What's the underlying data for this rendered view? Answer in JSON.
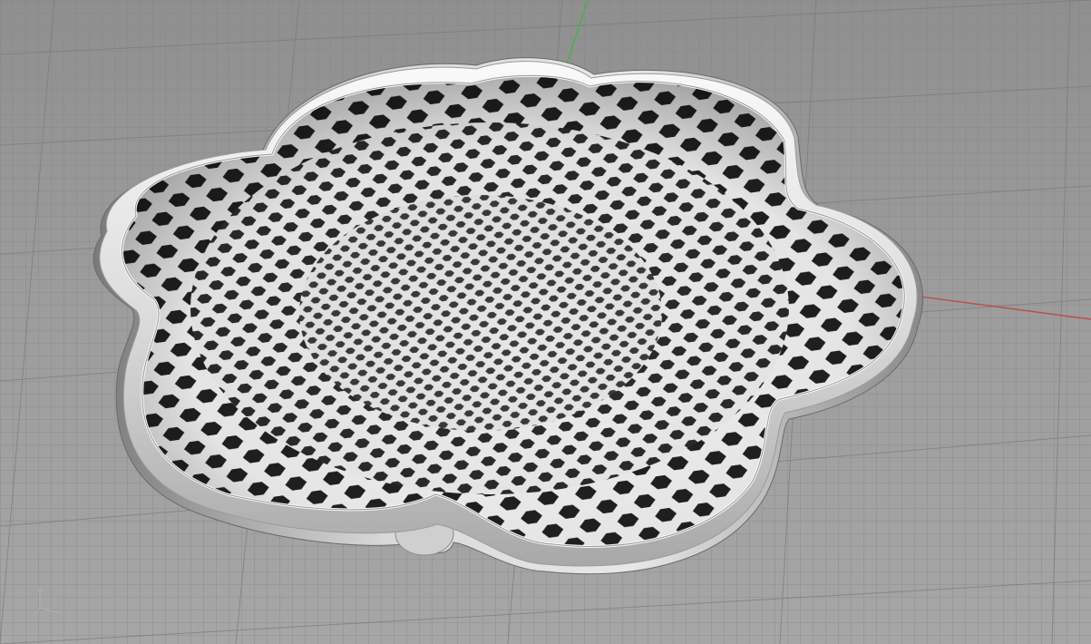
{
  "viewport": {
    "view_name": "Perspective",
    "background_color": "#9a9a9a",
    "grid_color": "#7f7f7f",
    "grid_major_color": "#6f6f6f",
    "x_axis_color": "#c0504d",
    "y_axis_color": "#4caf50"
  },
  "model": {
    "object": "flower-shaped-bowl",
    "pattern": "hexagonal-voronoi-lattice",
    "petals": 6,
    "surface_color": "#d9d9d9",
    "shadow_color": "#1a1a1a",
    "rim_highlight_color": "#f2f2f2"
  },
  "widgets": {
    "axis_gizmo_icon": "axis-gizmo-icon"
  }
}
